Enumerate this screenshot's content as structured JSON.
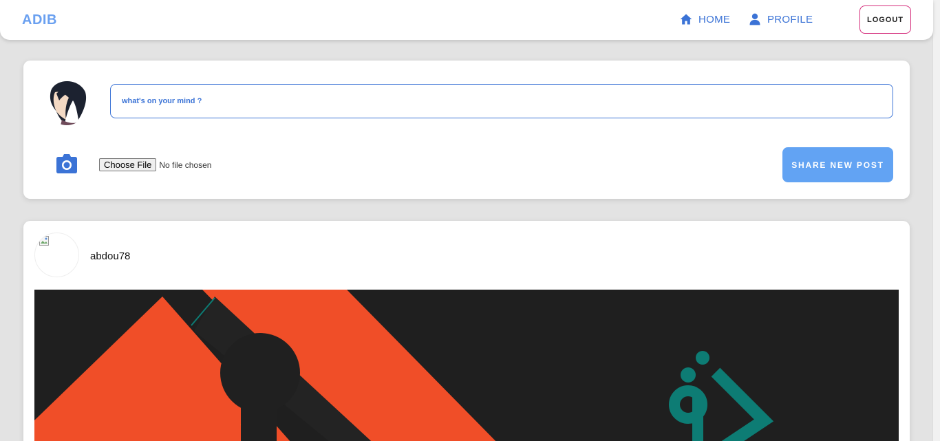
{
  "navbar": {
    "brand": "ADIB",
    "home_label": "HOME",
    "profile_label": "PROFILE",
    "logout_label": "LOGOUT"
  },
  "composer": {
    "placeholder": "what's on your mind ?",
    "choose_file_label": "Choose File",
    "file_status": "No file chosen",
    "share_label": "SHARE NEW POST"
  },
  "post": {
    "username": "abdou78"
  },
  "colors": {
    "accent": "#3b73d6",
    "brand": "#6aa0f0",
    "share_button": "#62a3f3",
    "logout_border": "#d42a7a",
    "post_orange": "#f04e28",
    "post_teal": "#0d7c74"
  },
  "icons": {
    "home": "home-icon",
    "profile": "user-icon",
    "camera": "camera-icon"
  }
}
